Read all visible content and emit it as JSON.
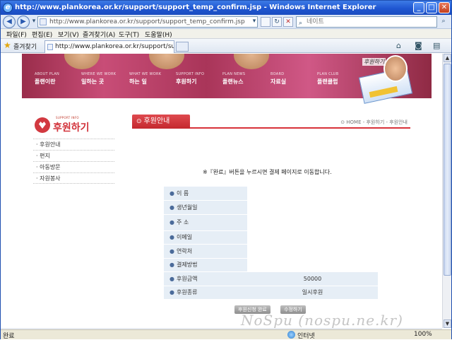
{
  "window": {
    "title": "http://www.plankorea.or.kr/support/support_temp_confirm.jsp - Windows Internet Explorer",
    "ie_glyph": "e",
    "minimize": "_",
    "maximize": "□",
    "close": "✕"
  },
  "navbar": {
    "back": "◀",
    "forward": "▶",
    "address": "http://www.plankorea.or.kr/support/support_temp_confirm.jsp",
    "search_placeholder": "네이트",
    "dropdown": "▾",
    "refresh": "↻",
    "stop": "✕"
  },
  "menubar": [
    "파일(F)",
    "편집(E)",
    "보기(V)",
    "즐겨찾기(A)",
    "도구(T)",
    "도움말(H)"
  ],
  "favorites": {
    "label": "즐겨찾기",
    "tab_title": "http://www.plankorea.or.kr/support/support..."
  },
  "site": {
    "nav": [
      {
        "en": "ABOUT PLAN",
        "ko": "플랜이란"
      },
      {
        "en": "WHERE WE WORK",
        "ko": "일하는 곳"
      },
      {
        "en": "WHAT WE WORK",
        "ko": "하는 일"
      },
      {
        "en": "SUPPORT INFO",
        "ko": "후원하기"
      },
      {
        "en": "PLAN NEWS",
        "ko": "플랜뉴스"
      },
      {
        "en": "BOARD",
        "ko": "자료실"
      },
      {
        "en": "PLAN CLUB",
        "ko": "플랜클럽"
      }
    ],
    "banner_signature": "후원하기",
    "logo_small": "SUPPORT INFO",
    "logo_big": "후원하기",
    "sidebar": [
      "후원안내",
      "편지",
      "아동방문",
      "자원봉사"
    ],
    "section_title": "후원안내",
    "breadcrumb": "HOME - 후원하기 - 후원안내",
    "notice": "※『완료』버튼을 누르시면 결제 페이지로 이동합니다.",
    "form_rows": [
      {
        "label": "이 름",
        "value": ""
      },
      {
        "label": "생년월일",
        "value": ""
      },
      {
        "label": "주 소",
        "value": ""
      },
      {
        "label": "이메일",
        "value": ""
      },
      {
        "label": "연락처",
        "value": ""
      },
      {
        "label": "결제방법",
        "value": ""
      },
      {
        "label": "후원금액",
        "value": "50000"
      },
      {
        "label": "후원종류",
        "value": "일시후원"
      }
    ],
    "buttons": {
      "complete": "후원신청 완료",
      "edit": "수정하기"
    }
  },
  "status": {
    "text": "완료",
    "zone": "인터넷",
    "zoom": "100%"
  },
  "watermark": "NoSpu (nospu.ne.kr)"
}
